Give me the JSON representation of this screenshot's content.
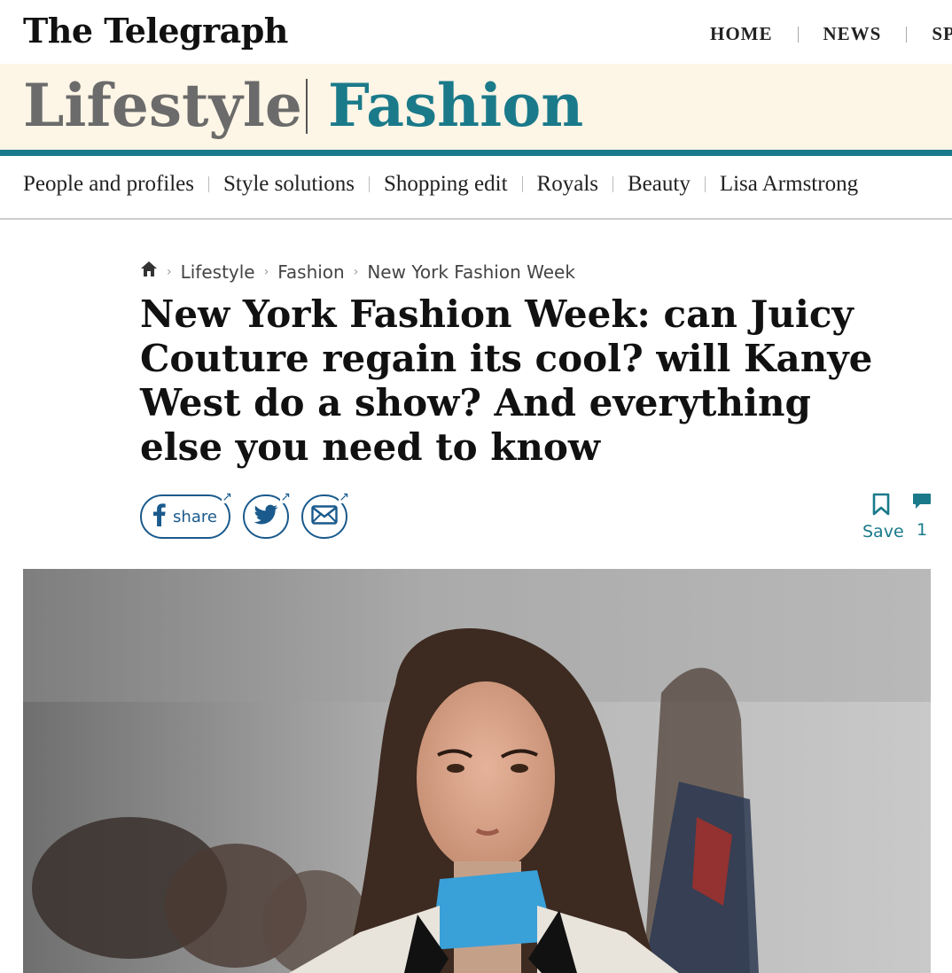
{
  "masthead": {
    "logo": "The Telegraph"
  },
  "top_nav": [
    "HOME",
    "NEWS",
    "SPORT"
  ],
  "section": {
    "parent": "Lifestyle",
    "current": "Fashion"
  },
  "sub_nav": [
    "People and profiles",
    "Style solutions",
    "Shopping edit",
    "Royals",
    "Beauty",
    "Lisa Armstrong"
  ],
  "breadcrumb": {
    "items": [
      "Lifestyle",
      "Fashion",
      "New York Fashion Week"
    ]
  },
  "article": {
    "headline": "New York Fashion Week: can Juicy Couture regain its cool? will Kanye West do a show? And everything else you need to know"
  },
  "share": {
    "facebook_label": "share"
  },
  "actions": {
    "save_label": "Save",
    "comment_count": "1"
  },
  "colors": {
    "accent": "#1a7a8a",
    "banner_bg": "#fdf5e6",
    "share_blue": "#1a5a8c"
  }
}
